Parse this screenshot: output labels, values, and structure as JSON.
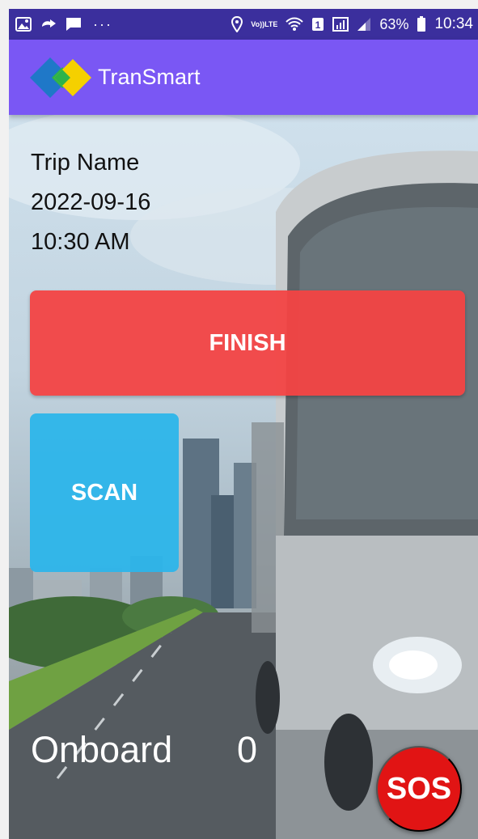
{
  "status_bar": {
    "left_icons": [
      "gallery-icon",
      "call-forward-icon",
      "message-icon"
    ],
    "more": "···",
    "right_icons": [
      "location-icon",
      "volte-icon",
      "wifi-icon",
      "sim-icon",
      "network-icon",
      "signal-icon"
    ],
    "volte_top": "Vo))",
    "volte_bottom": "LTE",
    "battery": "63%",
    "time": "10:34"
  },
  "app_bar": {
    "title": "TranSmart",
    "logo_colors": [
      "#1f78c8",
      "#2db34a",
      "#f5d000"
    ],
    "background": "#7a57f4"
  },
  "trip": {
    "name": "Trip Name",
    "date": "2022-09-16",
    "time": "10:30 AM"
  },
  "actions": {
    "finish_label": "FINISH",
    "finish_color": "#f34343",
    "scan_label": "SCAN",
    "scan_color": "#2cb5ea"
  },
  "onboard": {
    "label": "Onboard",
    "count": "0"
  },
  "sos": {
    "label": "SOS",
    "color": "#e11414"
  }
}
